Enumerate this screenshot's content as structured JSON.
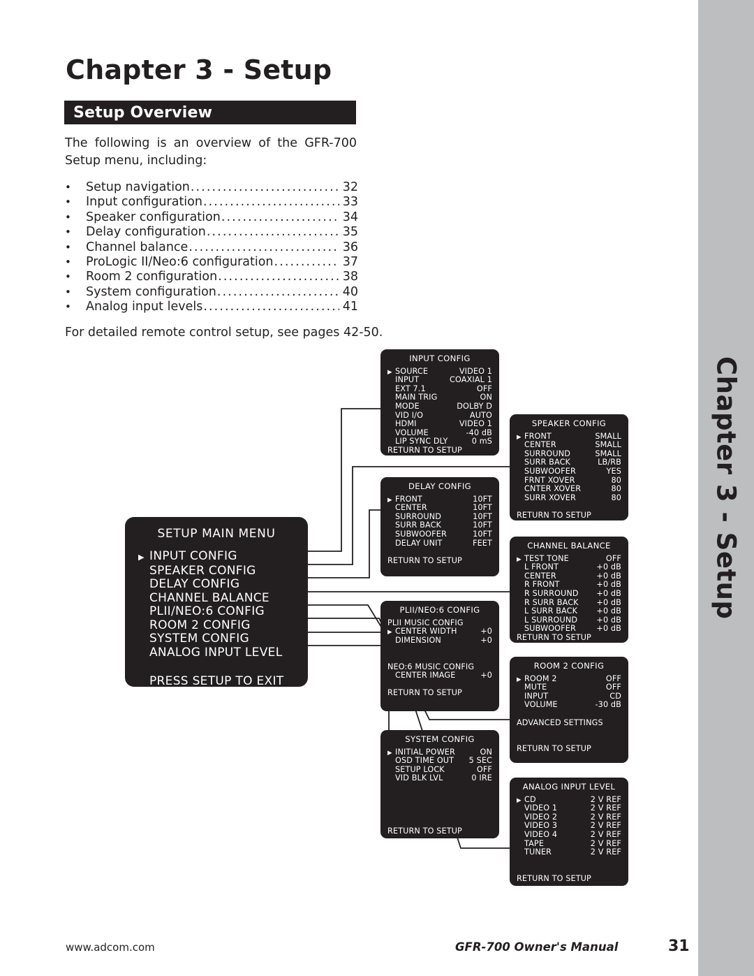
{
  "chapter_band": {
    "label": "Chapter 3 - Setup",
    "bg_color": "#bcbec0"
  },
  "page": {
    "title": "Chapter 3 - Setup",
    "section_header": "Setup Overview",
    "intro": "The following is an overview of the GFR-700 Setup menu, including:",
    "remote_note": "For detailed remote control setup, see pages 42-50.",
    "accent_color": "#231f20"
  },
  "toc": {
    "bullet": "•",
    "dots": "....................................................................",
    "items": [
      {
        "label": "Setup navigation",
        "page": "32"
      },
      {
        "label": "Input configuration",
        "page": "33"
      },
      {
        "label": "Speaker configuration",
        "page": "34"
      },
      {
        "label": "Delay configuration",
        "page": "35"
      },
      {
        "label": "Channel balance",
        "page": "36"
      },
      {
        "label": "ProLogic II/Neo:6 configuration",
        "page": "37"
      },
      {
        "label": "Room 2 configuration",
        "page": "38"
      },
      {
        "label": "System configuration",
        "page": "40"
      },
      {
        "label": "Analog input levels",
        "page": "41"
      }
    ]
  },
  "main_menu": {
    "title": "SETUP MAIN MENU",
    "caret": "▶",
    "items": [
      {
        "label": "INPUT CONFIG",
        "selected": true
      },
      {
        "label": "SPEAKER CONFIG",
        "selected": false
      },
      {
        "label": "DELAY CONFIG",
        "selected": false
      },
      {
        "label": "CHANNEL BALANCE",
        "selected": false
      },
      {
        "label": "PLII/NEO:6 CONFIG",
        "selected": false
      },
      {
        "label": "ROOM 2 CONFIG",
        "selected": false
      },
      {
        "label": "SYSTEM CONFIG",
        "selected": false
      },
      {
        "label": "ANALOG INPUT LEVEL",
        "selected": false
      }
    ],
    "exit_text": "PRESS SETUP TO EXIT"
  },
  "osd_caret": "▶",
  "return_label": "RETURN TO SETUP",
  "submenus": {
    "input_config": {
      "title": "INPUT CONFIG",
      "rows": [
        {
          "name": "SOURCE",
          "value": "VIDEO 1",
          "caret": true
        },
        {
          "name": "INPUT",
          "value": "COAXIAL 1",
          "caret": false
        },
        {
          "name": "EXT 7.1",
          "value": "OFF",
          "caret": false
        },
        {
          "name": "MAIN TRIG",
          "value": "ON",
          "caret": false
        },
        {
          "name": "MODE",
          "value": "DOLBY D",
          "caret": false
        },
        {
          "name": "VID I/O",
          "value": "AUTO",
          "caret": false
        },
        {
          "name": "HDMI",
          "value": "VIDEO 1",
          "caret": false
        },
        {
          "name": "VOLUME",
          "value": "-40 dB",
          "caret": false
        },
        {
          "name": "LIP SYNC DLY",
          "value": "0 mS",
          "caret": false
        }
      ],
      "footer": "RETURN TO SETUP"
    },
    "speaker_config": {
      "title": "SPEAKER CONFIG",
      "rows": [
        {
          "name": "FRONT",
          "value": "SMALL",
          "caret": true
        },
        {
          "name": "CENTER",
          "value": "SMALL",
          "caret": false
        },
        {
          "name": "SURROUND",
          "value": "SMALL",
          "caret": false
        },
        {
          "name": "SURR BACK",
          "value": "LB/RB",
          "caret": false
        },
        {
          "name": "SUBWOOFER",
          "value": "YES",
          "caret": false
        },
        {
          "name": "FRNT XOVER",
          "value": "80",
          "caret": false
        },
        {
          "name": "CNTER XOVER",
          "value": "80",
          "caret": false
        },
        {
          "name": "SURR XOVER",
          "value": "80",
          "caret": false
        }
      ],
      "footer": "RETURN TO SETUP"
    },
    "delay_config": {
      "title": "DELAY CONFIG",
      "rows": [
        {
          "name": "FRONT",
          "value": "10FT",
          "caret": true
        },
        {
          "name": "CENTER",
          "value": "10FT",
          "caret": false
        },
        {
          "name": "SURROUND",
          "value": "10FT",
          "caret": false
        },
        {
          "name": "SURR BACK",
          "value": "10FT",
          "caret": false
        },
        {
          "name": "SUBWOOFER",
          "value": "10FT",
          "caret": false
        },
        {
          "name": "DELAY UNIT",
          "value": "FEET",
          "caret": false
        }
      ],
      "footer": "RETURN TO SETUP"
    },
    "channel_balance": {
      "title": "CHANNEL BALANCE",
      "rows": [
        {
          "name": "TEST TONE",
          "value": "OFF",
          "caret": true
        },
        {
          "name": "L FRONT",
          "value": "+0 dB",
          "caret": false
        },
        {
          "name": "CENTER",
          "value": "+0 dB",
          "caret": false
        },
        {
          "name": "R FRONT",
          "value": "+0 dB",
          "caret": false
        },
        {
          "name": "R SURROUND",
          "value": "+0 dB",
          "caret": false
        },
        {
          "name": "R SURR BACK",
          "value": "+0 dB",
          "caret": false
        },
        {
          "name": "L SURR BACK",
          "value": "+0 dB",
          "caret": false
        },
        {
          "name": "L SURROUND",
          "value": "+0 dB",
          "caret": false
        },
        {
          "name": "SUBWOOFER",
          "value": "+0 dB",
          "caret": false
        }
      ],
      "footer": "RETURN TO SETUP"
    },
    "plii_neo6_config": {
      "title": "PLII/NEO:6 CONFIG",
      "group1_label": "PLII MUSIC CONFIG",
      "rows1": [
        {
          "name": "CENTER WIDTH",
          "value": "+0",
          "caret": true
        },
        {
          "name": "DIMENSION",
          "value": "+0",
          "caret": false
        }
      ],
      "group2_label": "NEO:6 MUSIC CONFIG",
      "rows2": [
        {
          "name": "CENTER IMAGE",
          "value": "+0",
          "caret": false
        }
      ],
      "footer": "RETURN TO SETUP"
    },
    "room2_config": {
      "title": "ROOM 2 CONFIG",
      "rows": [
        {
          "name": "ROOM 2",
          "value": "OFF",
          "caret": true
        },
        {
          "name": "MUTE",
          "value": "OFF",
          "caret": false
        },
        {
          "name": "INPUT",
          "value": "CD",
          "caret": false
        },
        {
          "name": "VOLUME",
          "value": "-30 dB",
          "caret": false
        }
      ],
      "advanced_label": "ADVANCED SETTINGS",
      "footer": "RETURN TO SETUP"
    },
    "system_config": {
      "title": "SYSTEM CONFIG",
      "rows": [
        {
          "name": "INITIAL POWER",
          "value": "ON",
          "caret": true
        },
        {
          "name": "OSD TIME OUT",
          "value": "5 SEC",
          "caret": false
        },
        {
          "name": "SETUP LOCK",
          "value": "OFF",
          "caret": false
        },
        {
          "name": "VID BLK LVL",
          "value": "0 IRE",
          "caret": false
        }
      ],
      "footer": "RETURN TO SETUP"
    },
    "analog_input_level": {
      "title": "ANALOG INPUT LEVEL",
      "rows": [
        {
          "name": "CD",
          "value": "2 V REF",
          "caret": true
        },
        {
          "name": "VIDEO 1",
          "value": "2 V REF",
          "caret": false
        },
        {
          "name": "VIDEO 2",
          "value": "2 V REF",
          "caret": false
        },
        {
          "name": "VIDEO 3",
          "value": "2 V REF",
          "caret": false
        },
        {
          "name": "VIDEO 4",
          "value": "2 V REF",
          "caret": false
        },
        {
          "name": "TAPE",
          "value": "2 V REF",
          "caret": false
        },
        {
          "name": "TUNER",
          "value": "2 V REF",
          "caret": false
        }
      ],
      "footer": "RETURN TO SETUP"
    }
  },
  "footer": {
    "url": "www.adcom.com",
    "manual": "GFR-700 Owner's Manual",
    "page_number": "31"
  }
}
